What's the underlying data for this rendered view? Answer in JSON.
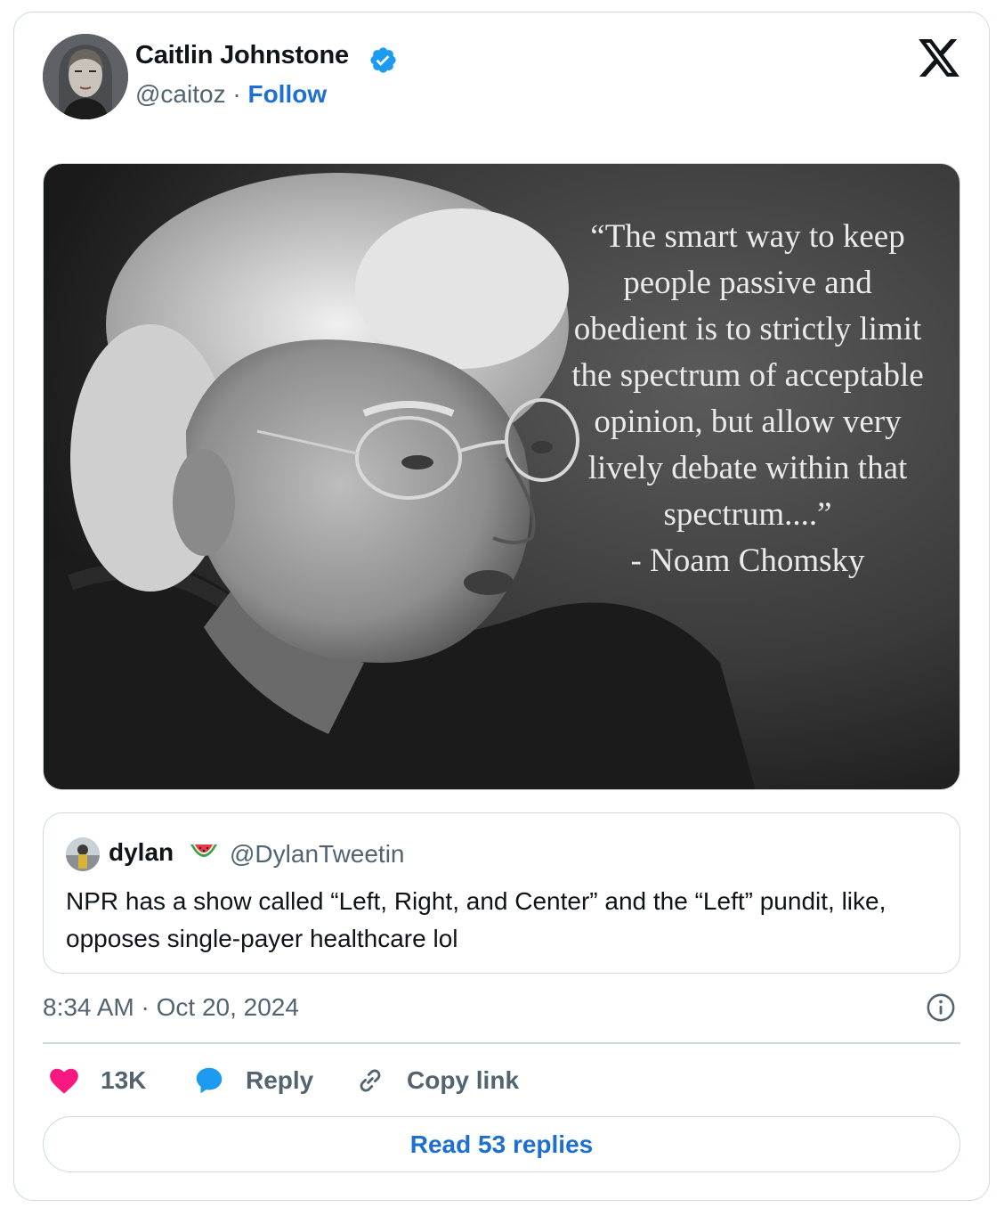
{
  "author": {
    "name": "Caitlin Johnstone",
    "handle": "@caitoz",
    "separator": "·",
    "follow_label": "Follow",
    "verified_icon": "verified-badge-icon"
  },
  "brand": {
    "logo": "x-logo-icon"
  },
  "media": {
    "quote_lines": [
      "“The smart way to keep",
      "people passive and",
      "obedient is to strictly limit",
      "the spectrum of acceptable",
      "opinion, but allow very",
      "lively debate within that",
      "spectrum....”",
      "- Noam Chomsky"
    ]
  },
  "quoted_tweet": {
    "name": "dylan",
    "emoji": "watermelon-icon",
    "handle": "@DylanTweetin",
    "text": "NPR has a show called “Left, Right, and Center” and the “Left” pundit, like, opposes single-payer healthcare lol"
  },
  "meta": {
    "timestamp": "8:34 AM · Oct 20, 2024"
  },
  "actions": {
    "likes": "13K",
    "reply_label": "Reply",
    "copy_link_label": "Copy link"
  },
  "read_replies_label": "Read 53 replies",
  "colors": {
    "accent": "#1d6fd1",
    "like": "#f91880",
    "reply_bubble": "#1d9bf0",
    "muted_text": "#536471",
    "border": "#cfd9de"
  }
}
